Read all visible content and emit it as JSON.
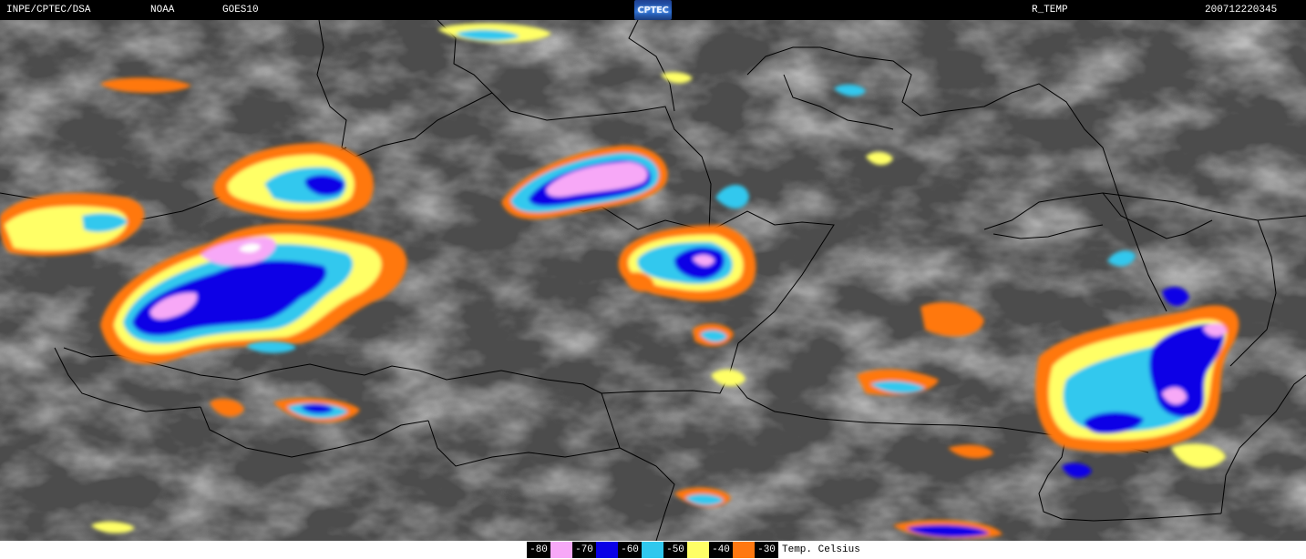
{
  "header": {
    "source": "INPE/CPTEC/DSA",
    "agency": "NOAA",
    "satellite": "GOES10",
    "logo_text": "CPTEC",
    "product": "R_TEMP",
    "timestamp": "200712220345"
  },
  "legend": {
    "title": "Temp. Celsius",
    "items": [
      {
        "label": "-80",
        "color": "#f7a8f7"
      },
      {
        "label": "-70",
        "color": "#0a00e6"
      },
      {
        "label": "-60",
        "color": "#30c8ee"
      },
      {
        "label": "-50",
        "color": "#ffff66"
      },
      {
        "label": "-40",
        "color": "#ff7810"
      },
      {
        "label": "-30",
        "color": "#ff7810"
      }
    ]
  },
  "map": {
    "background_color": "#4c4c4c",
    "border_color": "#000000"
  }
}
